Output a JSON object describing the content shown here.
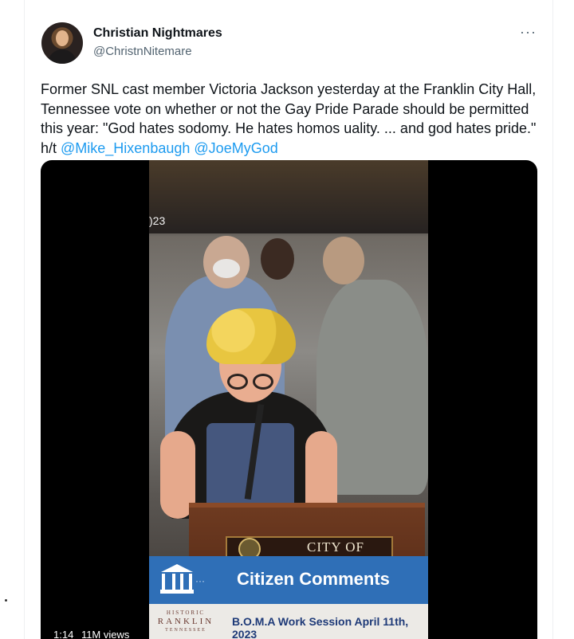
{
  "author": {
    "display_name": "Christian Nightmares",
    "handle": "@ChristnNitemare",
    "avatar_icon": "profile-avatar"
  },
  "menu": {
    "more_label": "···"
  },
  "tweet": {
    "text": "Former SNL cast member Victoria Jackson yesterday at the Franklin City Hall, Tennessee vote on whether or not the Gay Pride Parade should be permitted this year: \"God hates sodomy. He hates homos    uality. ... and god hates pride.\" h/t ",
    "mention_1": "@Mike_Hixenbaugh",
    "mention_2": "@JoeMyGod"
  },
  "video": {
    "timestamp_fragment": ")23",
    "podium_label": "CITY OF",
    "banner_title": "Citizen Comments",
    "banner_dots": "···",
    "logo_lines": [
      "HISTORIC",
      "RANKLIN",
      "TENNESSEE"
    ],
    "session_label": "B.O.M.A Work Session April 11th, 2023",
    "duration": "1:14",
    "views": "11M views"
  },
  "colors": {
    "link": "#1d9bf0",
    "banner_blue": "#2f6fb7",
    "handle_gray": "#536471"
  }
}
